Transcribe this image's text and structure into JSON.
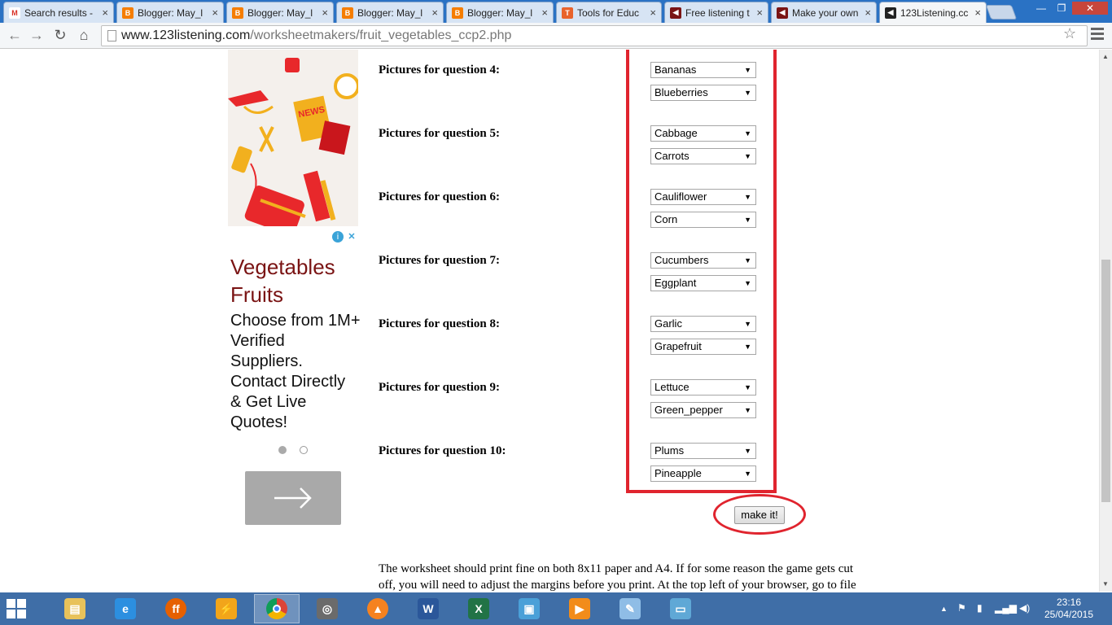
{
  "browser": {
    "tabs": [
      {
        "label": "Search results -",
        "favicon": "gmail-icon",
        "active": false
      },
      {
        "label": "Blogger: May_l",
        "favicon": "blogger-icon",
        "active": false
      },
      {
        "label": "Blogger: May_l",
        "favicon": "blogger-icon",
        "active": false
      },
      {
        "label": "Blogger: May_l",
        "favicon": "blogger-icon",
        "active": false
      },
      {
        "label": "Blogger: May_l",
        "favicon": "blogger-icon",
        "active": false
      },
      {
        "label": "Tools for Educ",
        "favicon": "tools-icon",
        "active": false
      },
      {
        "label": "Free listening t",
        "favicon": "speaker-icon",
        "active": false
      },
      {
        "label": "Make your own",
        "favicon": "speaker-icon",
        "active": false
      },
      {
        "label": "123Listening.cc",
        "favicon": "speaker-icon",
        "active": true
      }
    ],
    "url_domain": "www.123listening.com",
    "url_path": "/worksheetmakers/fruit_vegetables_ccp2.php"
  },
  "ad": {
    "headline": "Vegetables Fruits",
    "body": "Choose from 1M+ Verified Suppliers. Contact Directly & Get Live Quotes!",
    "image_badge": "NEWS",
    "colors": {
      "headline": "#7a1414",
      "accent": "#e8282b"
    }
  },
  "form": {
    "questions": [
      {
        "label": "Pictures for question 4:",
        "pic1": "Bananas",
        "pic2": "Blueberries"
      },
      {
        "label": "Pictures for question 5:",
        "pic1": "Cabbage",
        "pic2": "Carrots"
      },
      {
        "label": "Pictures for question 6:",
        "pic1": "Cauliflower",
        "pic2": "Corn"
      },
      {
        "label": "Pictures for question 7:",
        "pic1": "Cucumbers",
        "pic2": "Eggplant"
      },
      {
        "label": "Pictures for question 8:",
        "pic1": "Garlic",
        "pic2": "Grapefruit"
      },
      {
        "label": "Pictures for question 9:",
        "pic1": "Lettuce",
        "pic2": "Green_pepper"
      },
      {
        "label": "Pictures for question 10:",
        "pic1": "Plums",
        "pic2": "Pineapple"
      }
    ],
    "submit_label": "make it!",
    "highlight_color": "#e0242e"
  },
  "note": "The worksheet should print fine on both 8x11 paper and A4. If for some reason the game gets cut off, you will need to adjust the margins before you print. At the top left of your browser, go to file",
  "taskbar": {
    "apps": [
      "file-explorer-icon",
      "internet-explorer-icon",
      "firefox-icon",
      "winamp-icon",
      "chrome-icon",
      "movie-maker-icon",
      "vlc-icon",
      "word-icon",
      "excel-icon",
      "photo-gallery-icon",
      "media-player-icon",
      "paint-icon",
      "photo-viewer-icon"
    ],
    "clock_time": "23:16",
    "clock_date": "25/04/2015"
  }
}
